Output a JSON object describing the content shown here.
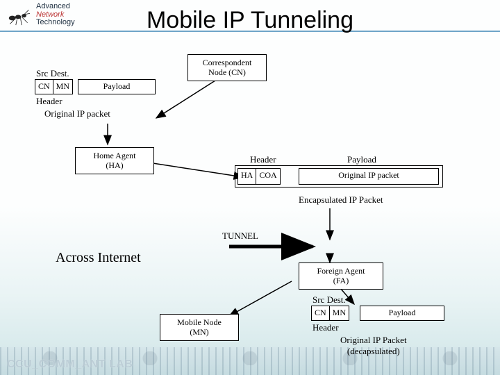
{
  "header": {
    "logo_lines": {
      "l1": "Advanced",
      "l2": "Network",
      "l3": "Technology"
    },
    "title": "Mobile IP Tunneling"
  },
  "footer": {
    "lab": "CCU_COMM_ANT LAB"
  },
  "diagram": {
    "src_dest": "Src Dest.",
    "header_label": "Header",
    "payload": "Payload",
    "original_ip_packet": "Original IP packet",
    "original_ip_packet_inner": "Original  IP  packet",
    "encapsulated": "Encapsulated  IP  Packet",
    "tunnel": "TUNNEL",
    "across_internet": "Across Internet",
    "decapsulated_l1": "Original  IP  Packet",
    "decapsulated_l2": "(decapsulated)",
    "nodes": {
      "cn_l1": "Correspondent",
      "cn_l2": "Node (CN)",
      "ha_l1": "Home Agent",
      "ha_l2": "(HA)",
      "fa_l1": "Foreign Agent",
      "fa_l2": "(FA)",
      "mn_l1": "Mobile Node",
      "mn_l2": "(MN)"
    },
    "cells": {
      "cn": "CN",
      "mn": "MN",
      "ha": "HA",
      "coa": "COA"
    }
  }
}
